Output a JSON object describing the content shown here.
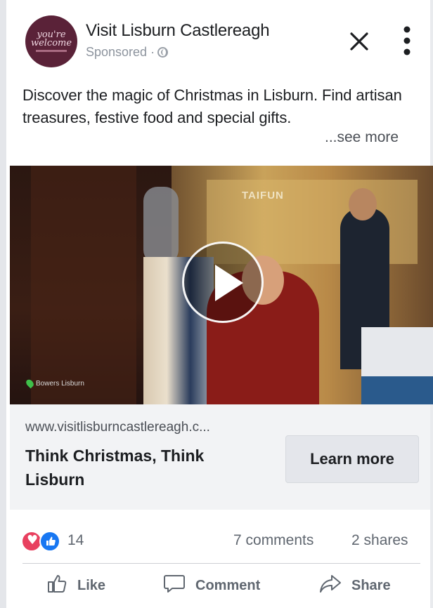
{
  "post": {
    "avatar": {
      "line1": "you're",
      "line2": "welcome"
    },
    "page_name": "Visit Lisburn Castlereagh",
    "sponsored": "Sponsored · ",
    "caption": "Discover the magic of Christmas in Lisburn. Find artisan treasures, festive food and special gifts.",
    "see_more": "...see more"
  },
  "video": {
    "sign_text": "TAIFUN",
    "location_text": "Bowers Lisburn"
  },
  "link": {
    "url": "www.visitlisburncastlereagh.c...",
    "title": "Think Christmas, Think Lisburn",
    "cta": "Learn more"
  },
  "engagement": {
    "reaction_count": "14",
    "comments": "7 comments",
    "shares": "2 shares"
  },
  "actions": {
    "like": "Like",
    "comment": "Comment",
    "share": "Share"
  },
  "colors": {
    "avatar_bg": "#5a2238",
    "link_box_bg": "#f2f3f5",
    "love_red": "#e8405f",
    "like_blue": "#1877f2"
  },
  "icons": [
    "globe-icon",
    "close-icon",
    "more-options-icon",
    "play-icon",
    "location-pin-icon",
    "love-reaction-icon",
    "like-reaction-icon",
    "thumbs-up-icon",
    "comment-icon",
    "share-icon"
  ]
}
